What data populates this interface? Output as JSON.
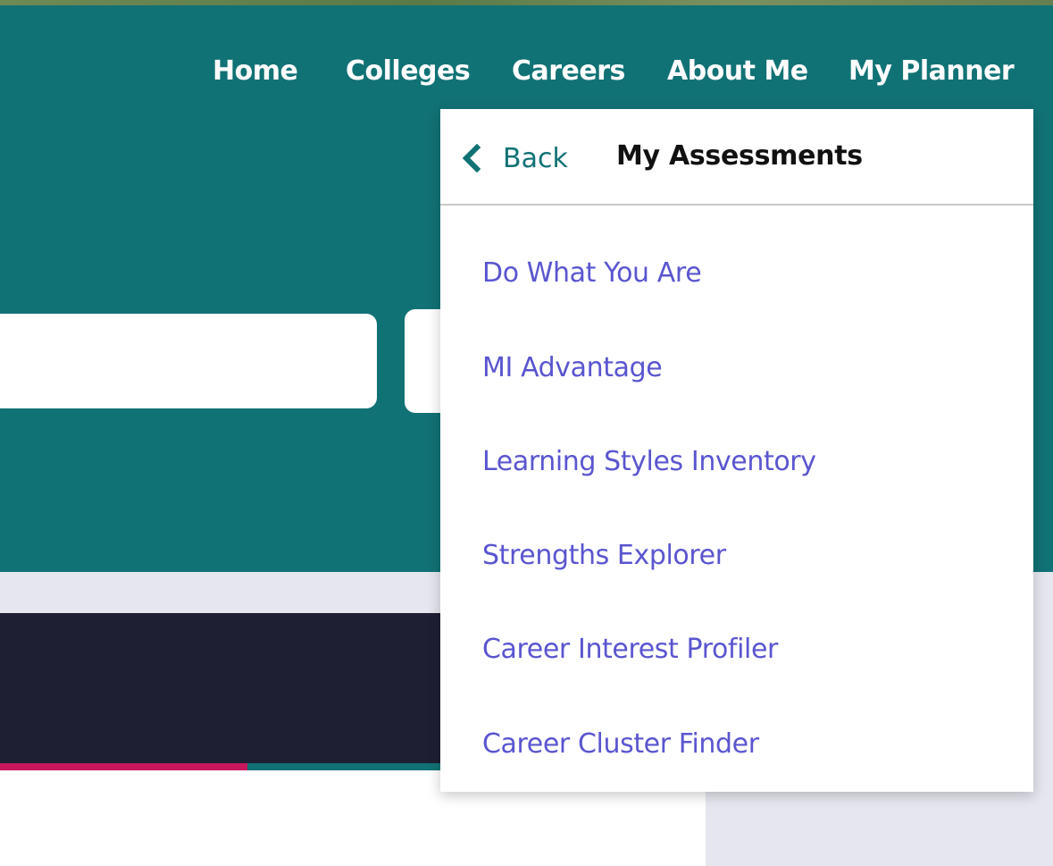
{
  "nav": {
    "home": "Home",
    "colleges": "Colleges",
    "careers": "Careers",
    "about_me": "About Me",
    "my_planner": "My Planner"
  },
  "dropdown": {
    "back_label": "Back",
    "back_icon": "chevron-left-icon",
    "title": "My Assessments",
    "items": [
      "Do What You Are",
      "MI Advantage",
      "Learning Styles Inventory",
      "Strengths Explorer",
      "Career Interest Profiler",
      "Career Cluster Finder"
    ]
  },
  "progress": {
    "fraction": 0.35
  },
  "colors": {
    "header_teal": "#117275",
    "link_purple": "#5a55d0",
    "banner_dark": "#1e1f33",
    "progress_pink": "#c8175d"
  }
}
